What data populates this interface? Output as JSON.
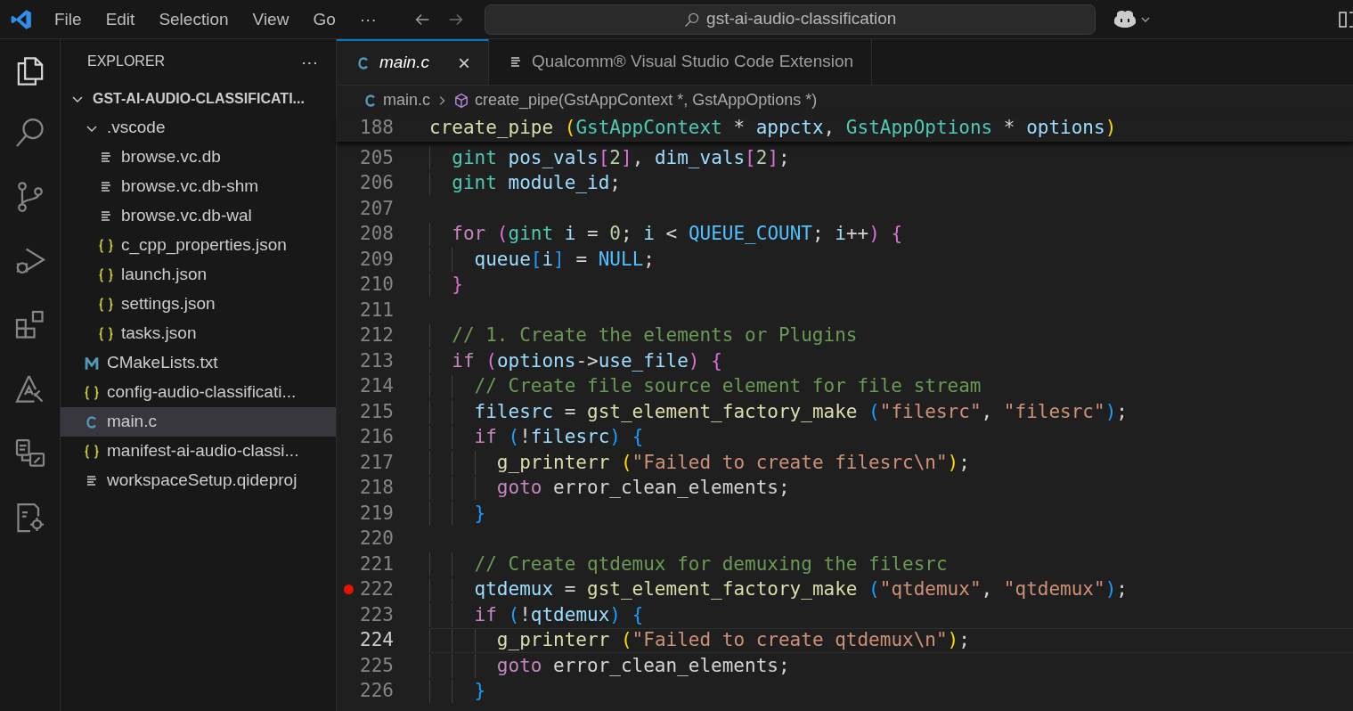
{
  "menu": [
    "File",
    "Edit",
    "Selection",
    "View",
    "Go",
    "···"
  ],
  "search": {
    "value": "gst-ai-audio-classification"
  },
  "explorer": {
    "title": "EXPLORER",
    "more": "···",
    "tree": [
      {
        "label": "GST-AI-AUDIO-CLASSIFICATI...",
        "kind": "folder",
        "expanded": true,
        "selected": false,
        "children": [
          {
            "label": ".vscode",
            "kind": "folder",
            "expanded": true,
            "selected": false,
            "children": [
              {
                "label": "browse.vc.db",
                "kind": "text",
                "selected": false
              },
              {
                "label": "browse.vc.db-shm",
                "kind": "text",
                "selected": false
              },
              {
                "label": "browse.vc.db-wal",
                "kind": "text",
                "selected": false
              },
              {
                "label": "c_cpp_properties.json",
                "kind": "json",
                "selected": false
              },
              {
                "label": "launch.json",
                "kind": "json",
                "selected": false
              },
              {
                "label": "settings.json",
                "kind": "json",
                "selected": false
              },
              {
                "label": "tasks.json",
                "kind": "json",
                "selected": false
              }
            ]
          },
          {
            "label": "CMakeLists.txt",
            "kind": "cmake",
            "selected": false
          },
          {
            "label": "config-audio-classificati...",
            "kind": "json",
            "selected": false
          },
          {
            "label": "main.c",
            "kind": "c",
            "selected": true
          },
          {
            "label": "manifest-ai-audio-classi...",
            "kind": "json",
            "selected": false
          },
          {
            "label": "workspaceSetup.qideproj",
            "kind": "text",
            "selected": false
          }
        ]
      }
    ]
  },
  "tabs": [
    {
      "label": "main.c",
      "kind": "c",
      "selected": true,
      "preview": true,
      "close": "×"
    },
    {
      "label": "Qualcomm® Visual Studio Code Extension",
      "kind": "text",
      "selected": false,
      "preview": false
    }
  ],
  "breadcrumb": [
    {
      "label": "main.c",
      "kind": "c"
    },
    {
      "label": "create_pipe(GstAppContext *, GstAppOptions *)",
      "kind": "symbol"
    }
  ],
  "sticky": {
    "number": "188",
    "tokens": [
      {
        "kind": "func",
        "text": "create_pipe "
      },
      {
        "kind": "b1",
        "text": "("
      },
      {
        "kind": "type",
        "text": "GstAppContext"
      },
      {
        "kind": "punct",
        "text": " * "
      },
      {
        "kind": "var",
        "text": "appctx"
      },
      {
        "kind": "punct",
        "text": ", "
      },
      {
        "kind": "type",
        "text": "GstAppOptions"
      },
      {
        "kind": "punct",
        "text": " * "
      },
      {
        "kind": "var",
        "text": "options"
      },
      {
        "kind": "b1",
        "text": ")"
      }
    ]
  },
  "code": {
    "lines": [
      {
        "number": "205",
        "breakpoint": false,
        "current": false,
        "tokens": [
          {
            "kind": "type",
            "text": "  gint "
          },
          {
            "kind": "var",
            "text": "pos_vals"
          },
          {
            "kind": "b2",
            "text": "["
          },
          {
            "kind": "num",
            "text": "2"
          },
          {
            "kind": "b2",
            "text": "]"
          },
          {
            "kind": "punct",
            "text": ", "
          },
          {
            "kind": "var",
            "text": "dim_vals"
          },
          {
            "kind": "b2",
            "text": "["
          },
          {
            "kind": "num",
            "text": "2"
          },
          {
            "kind": "b2",
            "text": "]"
          },
          {
            "kind": "punct",
            "text": ";"
          }
        ]
      },
      {
        "number": "206",
        "breakpoint": false,
        "current": false,
        "tokens": [
          {
            "kind": "type",
            "text": "  gint "
          },
          {
            "kind": "var",
            "text": "module_id"
          },
          {
            "kind": "punct",
            "text": ";"
          }
        ]
      },
      {
        "number": "207",
        "breakpoint": false,
        "current": false
      },
      {
        "number": "208",
        "breakpoint": false,
        "current": false,
        "tokens": [
          {
            "kind": "kw",
            "text": "  for "
          },
          {
            "kind": "b2",
            "text": "("
          },
          {
            "kind": "type",
            "text": "gint "
          },
          {
            "kind": "var",
            "text": "i"
          },
          {
            "kind": "punct",
            "text": " = "
          },
          {
            "kind": "num",
            "text": "0"
          },
          {
            "kind": "punct",
            "text": "; "
          },
          {
            "kind": "var",
            "text": "i"
          },
          {
            "kind": "punct",
            "text": " < "
          },
          {
            "kind": "const",
            "text": "QUEUE_COUNT"
          },
          {
            "kind": "punct",
            "text": "; "
          },
          {
            "kind": "var",
            "text": "i"
          },
          {
            "kind": "punct",
            "text": "++"
          },
          {
            "kind": "b2",
            "text": ") {"
          }
        ]
      },
      {
        "number": "209",
        "breakpoint": false,
        "current": false,
        "tokens": [
          {
            "kind": "var",
            "text": "    queue"
          },
          {
            "kind": "b3",
            "text": "["
          },
          {
            "kind": "var",
            "text": "i"
          },
          {
            "kind": "b3",
            "text": "]"
          },
          {
            "kind": "punct",
            "text": " = "
          },
          {
            "kind": "const",
            "text": "NULL"
          },
          {
            "kind": "punct",
            "text": ";"
          }
        ]
      },
      {
        "number": "210",
        "breakpoint": false,
        "current": false,
        "tokens": [
          {
            "kind": "b2",
            "text": "  }"
          }
        ]
      },
      {
        "number": "211",
        "breakpoint": false,
        "current": false
      },
      {
        "number": "212",
        "breakpoint": false,
        "current": false,
        "tokens": [
          {
            "kind": "com",
            "text": "  // 1. Create the elements or Plugins"
          }
        ]
      },
      {
        "number": "213",
        "breakpoint": false,
        "current": false,
        "tokens": [
          {
            "kind": "kw",
            "text": "  if "
          },
          {
            "kind": "b2",
            "text": "("
          },
          {
            "kind": "var",
            "text": "options"
          },
          {
            "kind": "punct",
            "text": "->"
          },
          {
            "kind": "var",
            "text": "use_file"
          },
          {
            "kind": "b2",
            "text": ") {"
          }
        ]
      },
      {
        "number": "214",
        "breakpoint": false,
        "current": false,
        "tokens": [
          {
            "kind": "com",
            "text": "    // Create file source element for file stream"
          }
        ]
      },
      {
        "number": "215",
        "breakpoint": false,
        "current": false,
        "tokens": [
          {
            "kind": "var",
            "text": "    filesrc"
          },
          {
            "kind": "punct",
            "text": " = "
          },
          {
            "kind": "func",
            "text": "gst_element_factory_make "
          },
          {
            "kind": "b3",
            "text": "("
          },
          {
            "kind": "str",
            "text": "\"filesrc\""
          },
          {
            "kind": "punct",
            "text": ", "
          },
          {
            "kind": "str",
            "text": "\"filesrc\""
          },
          {
            "kind": "b3",
            "text": ")"
          },
          {
            "kind": "punct",
            "text": ";"
          }
        ]
      },
      {
        "number": "216",
        "breakpoint": false,
        "current": false,
        "tokens": [
          {
            "kind": "kw",
            "text": "    if "
          },
          {
            "kind": "b3",
            "text": "("
          },
          {
            "kind": "punct",
            "text": "!"
          },
          {
            "kind": "var",
            "text": "filesrc"
          },
          {
            "kind": "b3",
            "text": ") {"
          }
        ]
      },
      {
        "number": "217",
        "breakpoint": false,
        "current": false,
        "tokens": [
          {
            "kind": "func",
            "text": "      g_printerr "
          },
          {
            "kind": "b1",
            "text": "("
          },
          {
            "kind": "str",
            "text": "\"Failed to create filesrc\\n\""
          },
          {
            "kind": "b1",
            "text": ")"
          },
          {
            "kind": "punct",
            "text": ";"
          }
        ]
      },
      {
        "number": "218",
        "breakpoint": false,
        "current": false,
        "tokens": [
          {
            "kind": "kw",
            "text": "      goto"
          },
          {
            "kind": "punct",
            "text": " error_clean_elements;"
          }
        ]
      },
      {
        "number": "219",
        "breakpoint": false,
        "current": false,
        "tokens": [
          {
            "kind": "b3",
            "text": "    }"
          }
        ]
      },
      {
        "number": "220",
        "breakpoint": false,
        "current": false
      },
      {
        "number": "221",
        "breakpoint": false,
        "current": false,
        "tokens": [
          {
            "kind": "com",
            "text": "    // Create qtdemux for demuxing the filesrc"
          }
        ]
      },
      {
        "number": "222",
        "breakpoint": true,
        "current": false,
        "tokens": [
          {
            "kind": "var",
            "text": "    qtdemux"
          },
          {
            "kind": "punct",
            "text": " = "
          },
          {
            "kind": "func",
            "text": "gst_element_factory_make "
          },
          {
            "kind": "b3",
            "text": "("
          },
          {
            "kind": "str",
            "text": "\"qtdemux\""
          },
          {
            "kind": "punct",
            "text": ", "
          },
          {
            "kind": "str",
            "text": "\"qtdemux\""
          },
          {
            "kind": "b3",
            "text": ")"
          },
          {
            "kind": "punct",
            "text": ";"
          }
        ]
      },
      {
        "number": "223",
        "breakpoint": false,
        "current": false,
        "tokens": [
          {
            "kind": "kw",
            "text": "    if "
          },
          {
            "kind": "b3",
            "text": "("
          },
          {
            "kind": "punct",
            "text": "!"
          },
          {
            "kind": "var",
            "text": "qtdemux"
          },
          {
            "kind": "b3",
            "text": ") {"
          }
        ]
      },
      {
        "number": "224",
        "breakpoint": false,
        "current": true,
        "tokens": [
          {
            "kind": "func",
            "text": "      g_printerr "
          },
          {
            "kind": "b1",
            "text": "("
          },
          {
            "kind": "str",
            "text": "\"Failed to create qtdemux\\n\""
          },
          {
            "kind": "b1",
            "text": ")"
          },
          {
            "kind": "punct",
            "text": ";"
          }
        ]
      },
      {
        "number": "225",
        "breakpoint": false,
        "current": false,
        "tokens": [
          {
            "kind": "kw",
            "text": "      goto"
          },
          {
            "kind": "punct",
            "text": " error_clean_elements;"
          }
        ]
      },
      {
        "number": "226",
        "breakpoint": false,
        "current": false,
        "tokens": [
          {
            "kind": "b3",
            "text": "    }"
          }
        ]
      }
    ]
  }
}
